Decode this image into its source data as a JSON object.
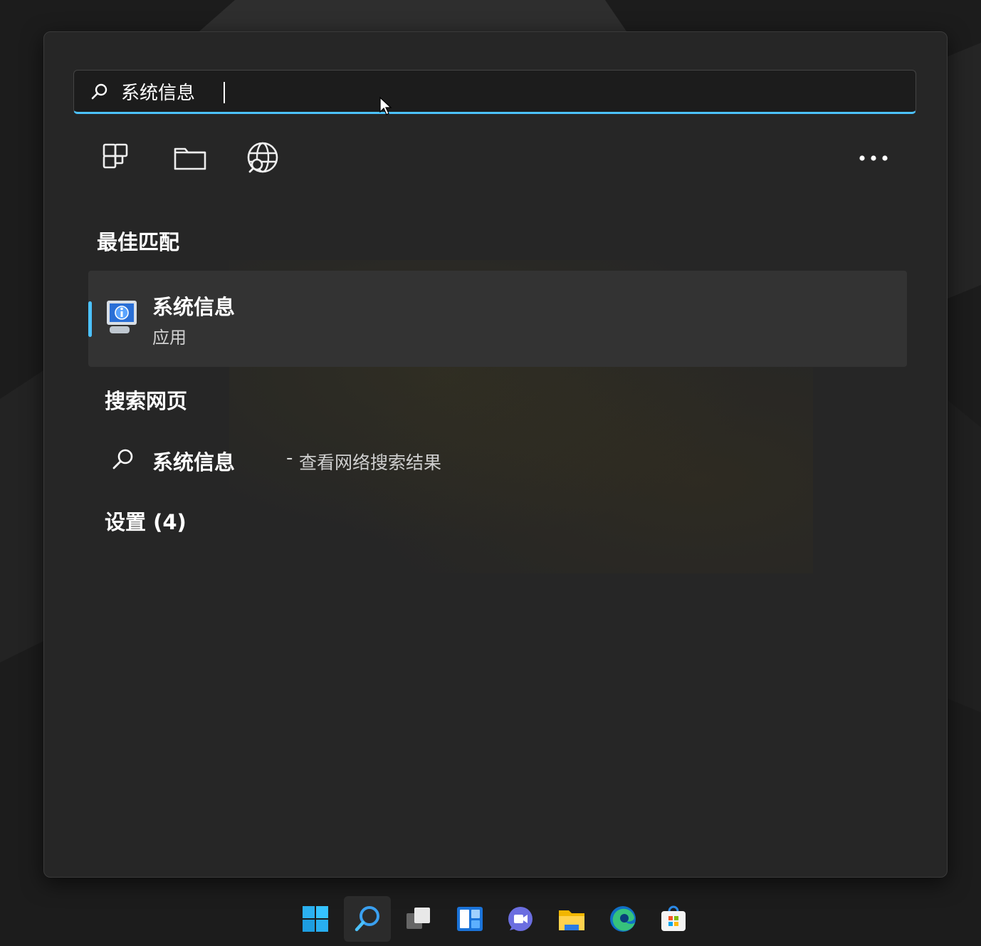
{
  "search": {
    "value": "系统信息",
    "placeholder": ""
  },
  "filters": [
    {
      "icon": "apps-filter-icon"
    },
    {
      "icon": "folder-filter-icon"
    },
    {
      "icon": "web-filter-icon"
    }
  ],
  "more_icon": "more-options-icon",
  "best_match": {
    "title": "最佳匹配",
    "name": "系统信息",
    "type": "应用",
    "icon": "system-information-app-icon"
  },
  "web": {
    "title": "搜索网页",
    "query": "系统信息",
    "separator": "-",
    "hint": "查看网络搜索结果"
  },
  "settings": {
    "title": "设置 (4)"
  },
  "taskbar": {
    "items": [
      {
        "icon": "windows-start-icon"
      },
      {
        "icon": "search-icon",
        "active": true
      },
      {
        "icon": "task-view-icon"
      },
      {
        "icon": "widgets-icon"
      },
      {
        "icon": "teams-chat-icon"
      },
      {
        "icon": "file-explorer-icon"
      },
      {
        "icon": "edge-browser-icon"
      },
      {
        "icon": "microsoft-store-icon"
      }
    ]
  },
  "colors": {
    "accent": "#4cc2ff",
    "panel": "#262626",
    "selected": "#333333"
  }
}
